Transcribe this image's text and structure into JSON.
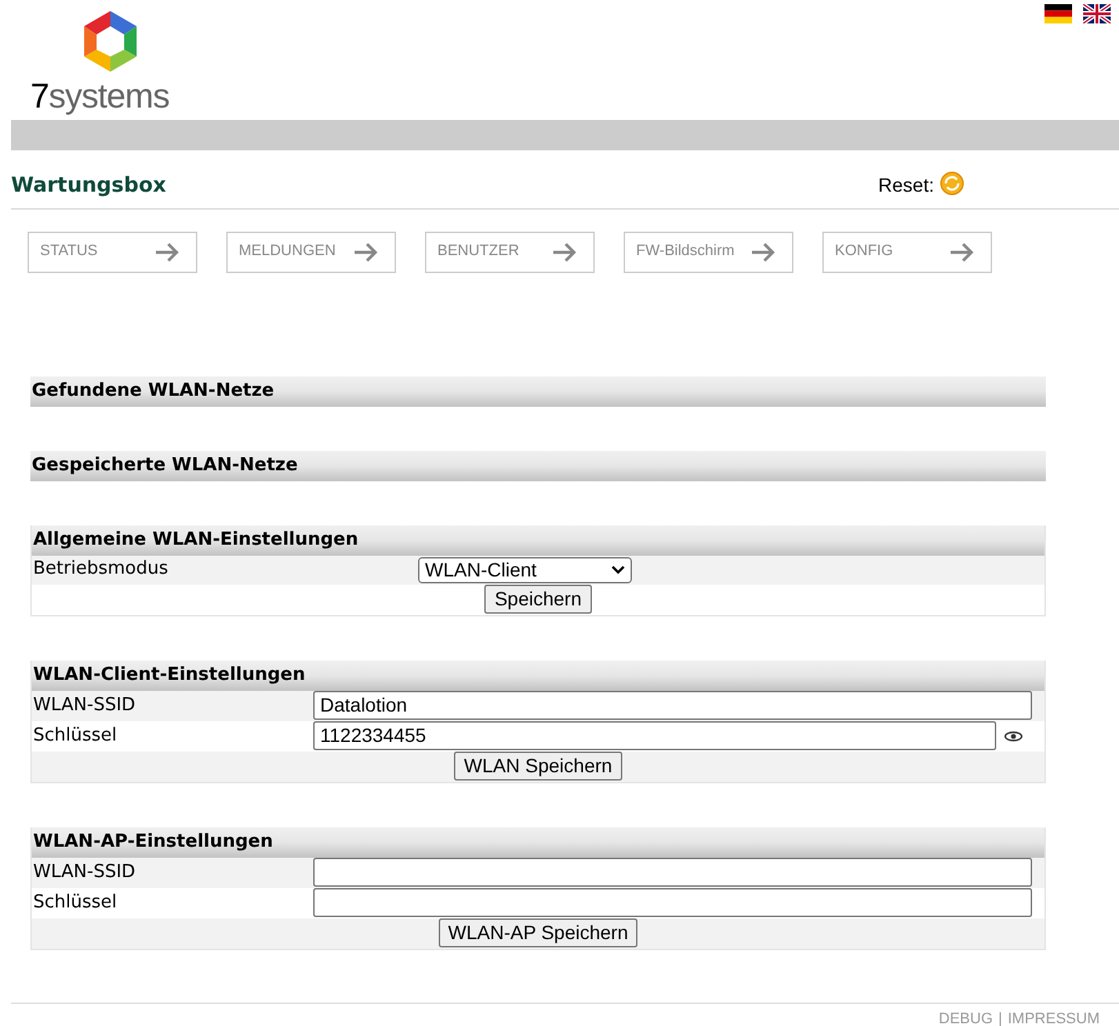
{
  "logo": {
    "digit": "7",
    "word": "systems"
  },
  "title": "Wartungsbox",
  "reset": {
    "label": "Reset:"
  },
  "nav": [
    {
      "label": "STATUS"
    },
    {
      "label": "MELDUNGEN"
    },
    {
      "label": "BENUTZER"
    },
    {
      "label": "FW-Bildschirm"
    },
    {
      "label": "KONFIG"
    }
  ],
  "sections": [
    {
      "title": "Gefundene WLAN-Netze"
    },
    {
      "title": "Gespeicherte WLAN-Netze"
    },
    {
      "title": "Allgemeine WLAN-Einstellungen",
      "rows": [
        {
          "kind": "select",
          "label": "Betriebsmodus",
          "value": "WLAN-Client"
        },
        {
          "kind": "button",
          "label": "Speichern"
        }
      ]
    },
    {
      "title": "WLAN-Client-Einstellungen",
      "rows": [
        {
          "kind": "input",
          "label": "WLAN-SSID",
          "value": "Datalotion"
        },
        {
          "kind": "password",
          "label": "Schlüssel",
          "value": "1122334455"
        },
        {
          "kind": "button",
          "label": "WLAN Speichern"
        }
      ]
    },
    {
      "title": "WLAN-AP-Einstellungen",
      "rows": [
        {
          "kind": "input",
          "label": "WLAN-SSID"
        },
        {
          "kind": "input",
          "label": "Schlüssel"
        },
        {
          "kind": "button",
          "label": "WLAN-AP Speichern"
        }
      ]
    }
  ],
  "footer": {
    "links": [
      {
        "label": "DEBUG"
      },
      {
        "label": "IMPRESSUM"
      }
    ],
    "separator": "|"
  }
}
